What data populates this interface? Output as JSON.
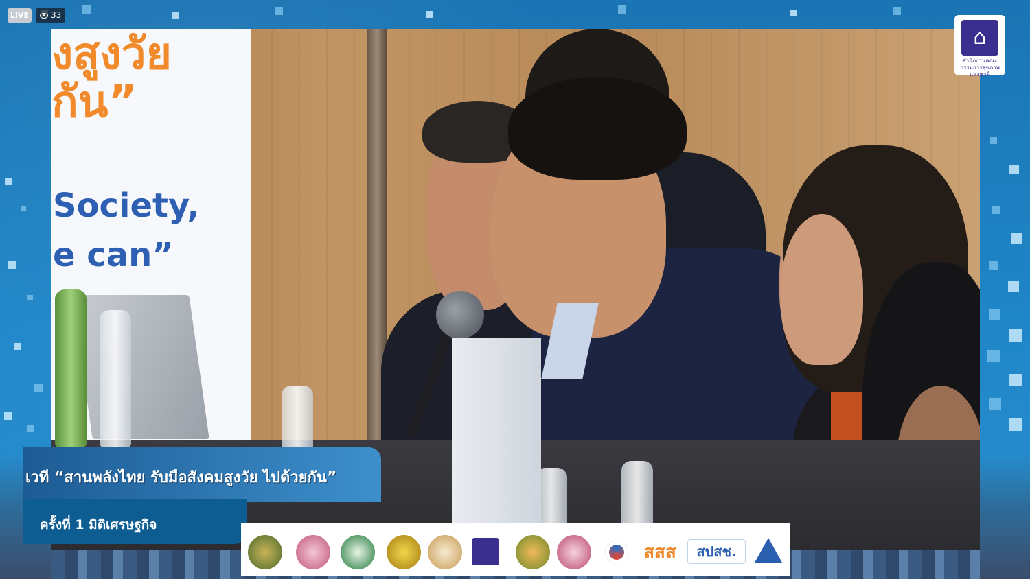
{
  "stream": {
    "live_label": "LIVE",
    "viewer_count": "33"
  },
  "slide": {
    "thai_text": "งสูงวัย\nกัน”",
    "english_text": "Society,\ne can”"
  },
  "lower_third": {
    "title": "เวที “สานพลังไทย รับมือสังคมสูงวัย ไปด้วยกัน”",
    "subtitle": "ครั้งที่ 1 มิติเศรษฐกิจ"
  },
  "logo": {
    "caption": "สำนักงานคณะกรรมการสุขภาพแห่งชาติ"
  },
  "sponsors": [
    {
      "icon": "seal-gold-green"
    },
    {
      "icon": "seal-pink"
    },
    {
      "icon": "seal-green-health"
    },
    {
      "icon": "seal-yellow"
    },
    {
      "icon": "seal-gold"
    },
    {
      "icon": "nationalhealth-logo"
    },
    {
      "icon": "tree-logo"
    },
    {
      "icon": "seal-pink-2"
    },
    {
      "icon": "ring-logo"
    },
    {
      "icon": "sss-logo",
      "text": "สสส"
    },
    {
      "icon": "spsch-logo",
      "text": "สปสช."
    },
    {
      "icon": "triangle-logo"
    }
  ],
  "colors": {
    "frame_blue": "#1f7fbf",
    "title_bar": "#2b6fa9",
    "subtitle_bar": "#0d5d93",
    "slide_orange": "#f08a2a",
    "slide_blue": "#2d5fb3"
  }
}
